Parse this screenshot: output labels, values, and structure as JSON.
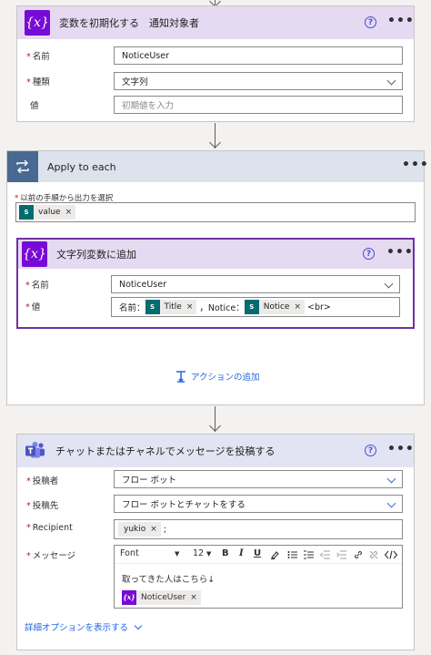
{
  "colors": {
    "variable_accent": "#770bd6",
    "apply_accent": "#4b6a88",
    "teams_accent": "#4b53bc",
    "sharepoint_token": "#036c70",
    "link": "#2266e3"
  },
  "init_var": {
    "title": "変数を初期化する　通知対象者",
    "fields": {
      "name_label": "名前",
      "name_value": "NoticeUser",
      "type_label": "種類",
      "type_value": "文字列",
      "value_label": "値",
      "value_placeholder": "初期値を入力"
    }
  },
  "apply_each": {
    "title": "Apply to each",
    "select_label": "以前の手順から出力を選択",
    "token": "value",
    "append": {
      "title": "文字列変数に追加",
      "name_label": "名前",
      "name_value": "NoticeUser",
      "value_label": "値",
      "value_text_1": "名前：",
      "token_title": "Title",
      "value_text_2": "，Notice：",
      "token_notice": "Notice",
      "value_text_3": "<br>"
    },
    "add_action": "アクションの追加"
  },
  "teams_post": {
    "title": "チャットまたはチャネルでメッセージを投稿する",
    "poster_label": "投稿者",
    "poster_value": "フロー ボット",
    "post_in_label": "投稿先",
    "post_in_value": "フロー ボットとチャットをする",
    "recipient_label": "Recipient",
    "recipient_token": "yukio",
    "recipient_suffix": ";",
    "message_label": "メッセージ",
    "toolbar": {
      "font": "Font",
      "size": "12"
    },
    "message_text": "取ってきた人はこちら↓",
    "message_token": "NoticeUser",
    "advanced_link": "詳細オプションを表示する"
  },
  "icons": {
    "help": "?",
    "more": "•••",
    "token_remove": "×",
    "var_glyph": "{x}",
    "sp_glyph": "S"
  }
}
